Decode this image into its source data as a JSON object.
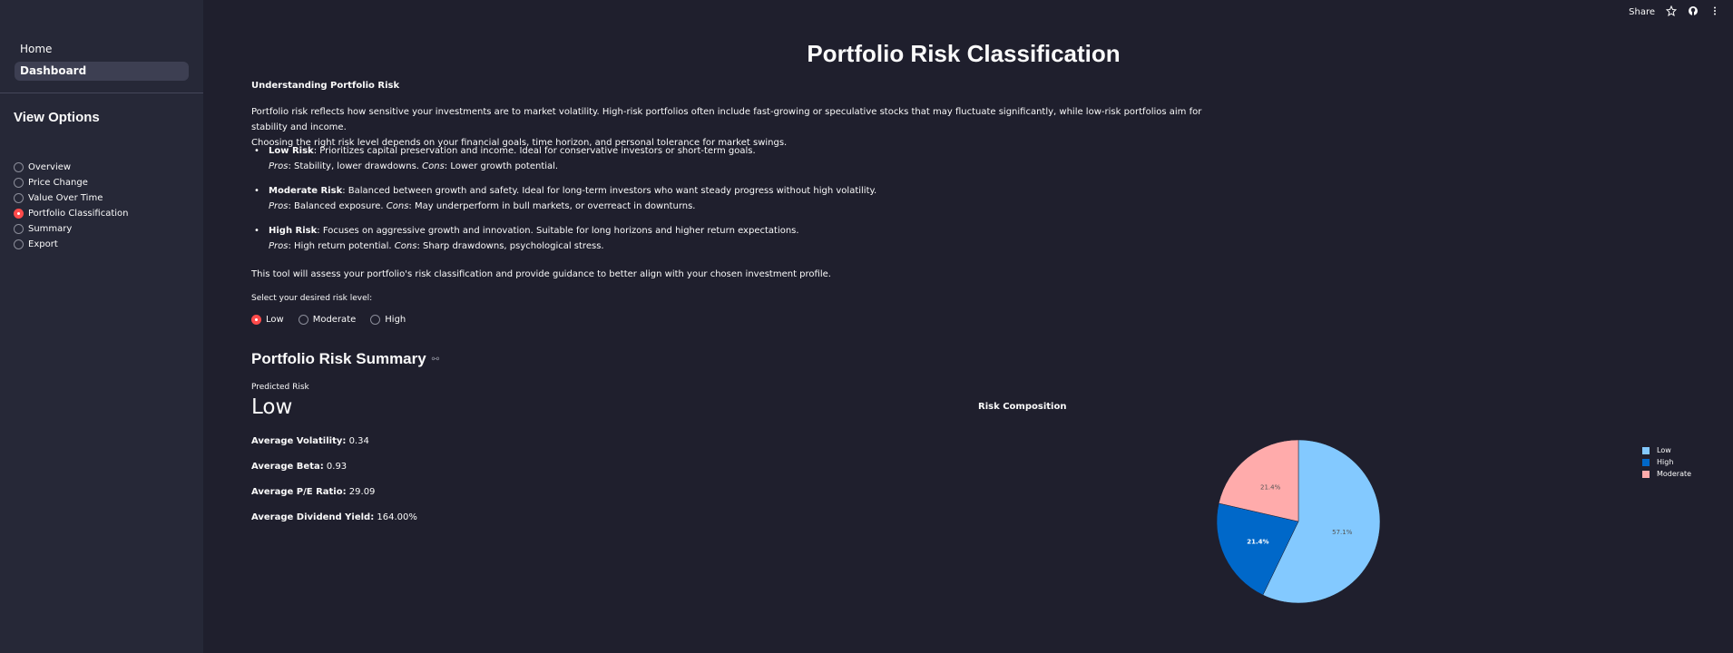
{
  "sidebar": {
    "nav": [
      {
        "label": "Home",
        "active": false
      },
      {
        "label": "Dashboard",
        "active": true
      }
    ],
    "view_title": "View Options",
    "options": [
      {
        "label": "Overview",
        "selected": false
      },
      {
        "label": "Price Change",
        "selected": false
      },
      {
        "label": "Value Over Time",
        "selected": false
      },
      {
        "label": "Portfolio Classification",
        "selected": true
      },
      {
        "label": "Summary",
        "selected": false
      },
      {
        "label": "Export",
        "selected": false
      }
    ]
  },
  "toolbar": {
    "share_label": "Share",
    "icons": [
      "star-icon",
      "github-icon",
      "more-vertical-icon"
    ]
  },
  "main": {
    "title": "Portfolio Risk Classification",
    "understanding_head": "Understanding Portfolio Risk",
    "intro_line1": "Portfolio risk reflects how sensitive your investments are to market volatility. High-risk portfolios often include fast-growing or speculative stocks that may fluctuate significantly, while low-risk portfolios aim for stability and income.",
    "intro_line2": "Choosing the right risk level depends on your financial goals, time horizon, and personal tolerance for market swings.",
    "bullets": [
      {
        "name": "Low Risk",
        "desc": ": Prioritizes capital preservation and income. Ideal for conservative investors or short-term goals.",
        "pros_label": "Pros",
        "pros": ": Stability, lower drawdowns. ",
        "cons_label": "Cons",
        "cons": ": Lower growth potential."
      },
      {
        "name": "Moderate Risk",
        "desc": ": Balanced between growth and safety. Ideal for long-term investors who want steady progress without high volatility.",
        "pros_label": "Pros",
        "pros": ": Balanced exposure. ",
        "cons_label": "Cons",
        "cons": ": May underperform in bull markets, or overreact in downturns."
      },
      {
        "name": "High Risk",
        "desc": ": Focuses on aggressive growth and innovation. Suitable for long horizons and higher return expectations.",
        "pros_label": "Pros",
        "pros": ": High return potential. ",
        "cons_label": "Cons",
        "cons": ": Sharp drawdowns, psychological stress."
      }
    ],
    "tool_text": "This tool will assess your portfolio's risk classification and provide guidance to better align with your chosen investment profile.",
    "risk_prompt": "Select your desired risk level:",
    "risk_options": [
      {
        "label": "Low",
        "selected": true
      },
      {
        "label": "Moderate",
        "selected": false
      },
      {
        "label": "High",
        "selected": false
      }
    ],
    "summary_head": "Portfolio Risk Summary",
    "predicted_label": "Predicted Risk",
    "predicted_value": "Low",
    "stats": [
      {
        "label": "Average Volatility:",
        "value": " 0.34"
      },
      {
        "label": "Average Beta:",
        "value": " 0.93"
      },
      {
        "label": "Average P/E Ratio:",
        "value": " 29.09"
      },
      {
        "label": "Average Dividend Yield:",
        "value": " 164.00%"
      }
    ]
  },
  "chart_data": {
    "type": "pie",
    "title": "Risk Composition",
    "slices": [
      {
        "label": "Low",
        "value": 57.1,
        "text": "57.1%",
        "color": "#83c9ff",
        "text_color": "#555555"
      },
      {
        "label": "High",
        "value": 21.4,
        "text": "21.4%",
        "color": "#0068c9",
        "text_color": "#ffffff"
      },
      {
        "label": "Moderate",
        "value": 21.4,
        "text": "21.4%",
        "color": "#ffabab",
        "text_color": "#555555"
      }
    ],
    "legend": [
      "Low",
      "High",
      "Moderate"
    ],
    "legend_position": "right"
  },
  "colors": {
    "background": "#1f1f2d",
    "sidebar": "#262837",
    "accent": "#ff4b4b"
  }
}
